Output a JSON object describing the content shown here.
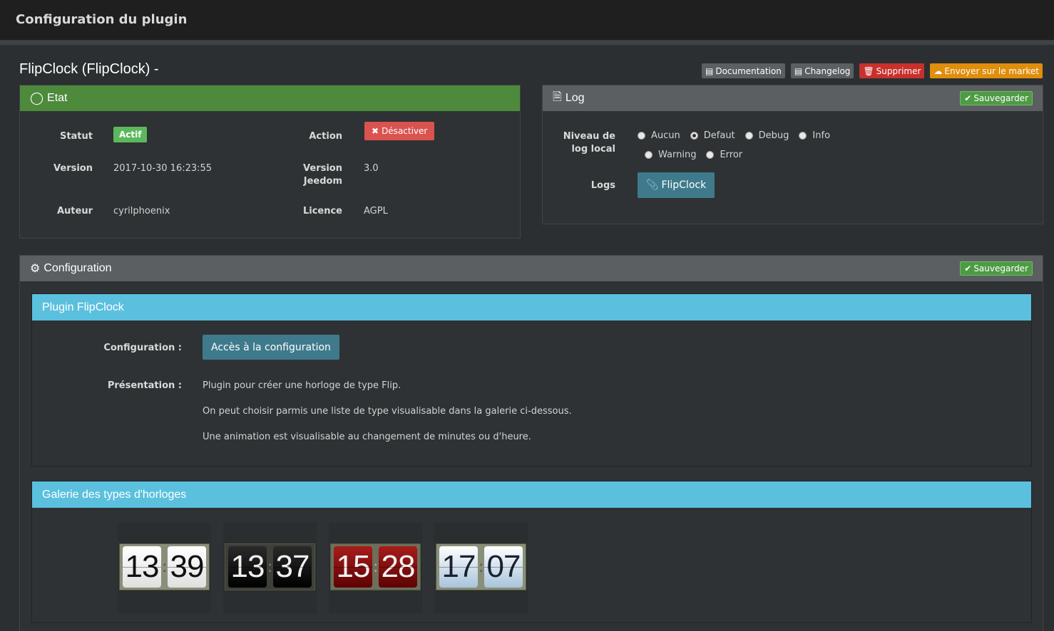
{
  "header": {
    "title": "Configuration du plugin"
  },
  "plugin": {
    "name": "FlipClock (FlipClock) -"
  },
  "actions": {
    "documentation": "Documentation",
    "changelog": "Changelog",
    "supprimer": "Supprimer",
    "market": "Envoyer sur le market"
  },
  "etat": {
    "title": "Etat",
    "statut_label": "Statut",
    "statut_value": "Actif",
    "action_label": "Action",
    "action_button": "Désactiver",
    "version_label": "Version",
    "version_value": "2017-10-30 16:23:55",
    "jeedom_label_1": "Version",
    "jeedom_label_2": "Jeedom",
    "jeedom_value": "3.0",
    "auteur_label": "Auteur",
    "auteur_value": "cyrilphoenix",
    "licence_label": "Licence",
    "licence_value": "AGPL"
  },
  "log": {
    "title": "Log",
    "save": "Sauvegarder",
    "niveau_label_1": "Niveau de",
    "niveau_label_2": "log local",
    "levels": [
      "Aucun",
      "Defaut",
      "Debug",
      "Info",
      "Warning",
      "Error"
    ],
    "selected": "Defaut",
    "logs_label": "Logs",
    "logs_button": "FlipClock"
  },
  "configuration": {
    "title": "Configuration",
    "save": "Sauvegarder",
    "subpanel_title": "Plugin FlipClock",
    "config_label": "Configuration :",
    "config_button": "Accès à la configuration",
    "presentation_label": "Présentation :",
    "lines": [
      "Plugin pour créer une horloge de type Flip.",
      "On peut choisir parmis une liste de type visualisable dans la galerie ci-dessous.",
      "Une animation est visualisable au changement de minutes ou d'heure."
    ]
  },
  "gallery": {
    "title": "Galerie des types d'horloges",
    "clocks": [
      {
        "hours": "13",
        "minutes": "39",
        "theme": "white"
      },
      {
        "hours": "13",
        "minutes": "37",
        "theme": "black"
      },
      {
        "hours": "15",
        "minutes": "28",
        "theme": "red"
      },
      {
        "hours": "17",
        "minutes": "07",
        "theme": "blue"
      }
    ]
  }
}
